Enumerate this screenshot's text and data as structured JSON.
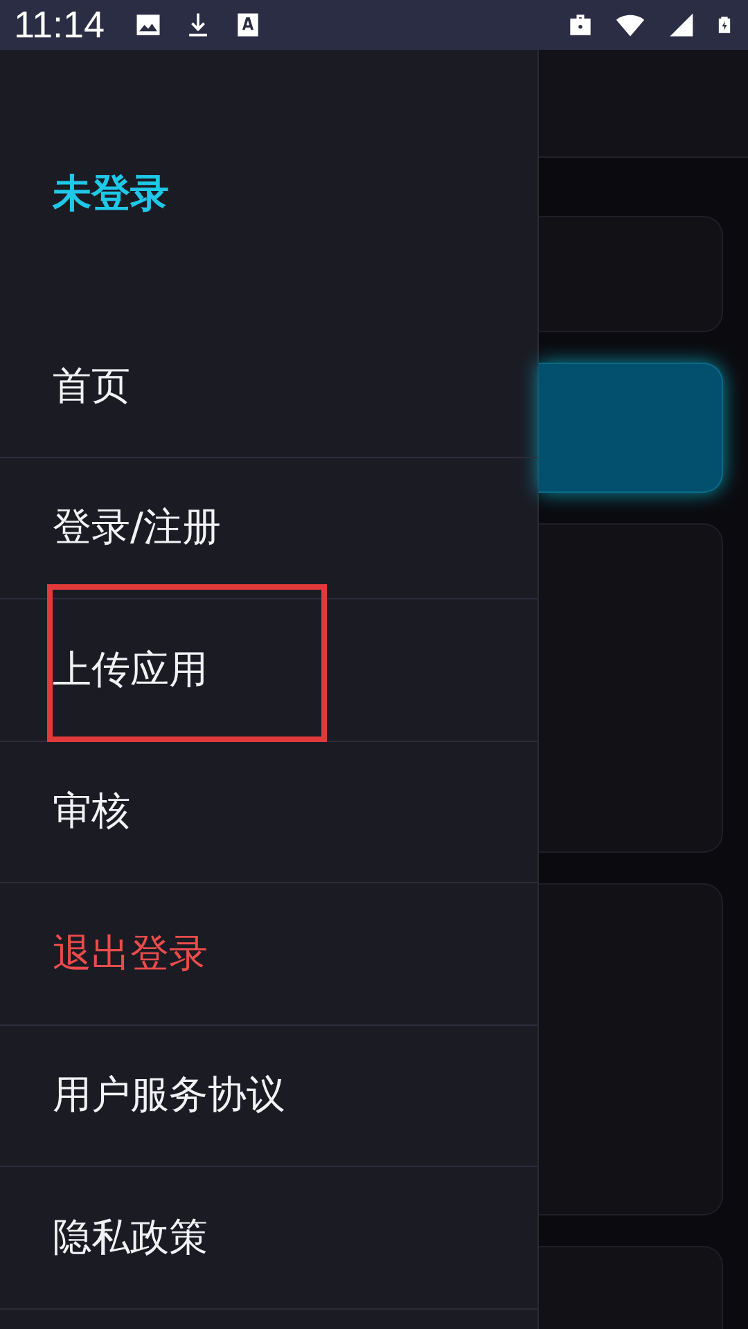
{
  "status_bar": {
    "time": "11:14"
  },
  "drawer": {
    "account_label": "未登录",
    "items": [
      {
        "label": "首页",
        "kind": "normal",
        "highlighted": false
      },
      {
        "label": "登录/注册",
        "kind": "normal",
        "highlighted": false
      },
      {
        "label": "上传应用",
        "kind": "normal",
        "highlighted": true
      },
      {
        "label": "审核",
        "kind": "normal",
        "highlighted": false
      },
      {
        "label": "退出登录",
        "kind": "danger",
        "highlighted": false
      },
      {
        "label": "用户服务协议",
        "kind": "normal",
        "highlighted": false
      },
      {
        "label": "隐私政策",
        "kind": "normal",
        "highlighted": false
      }
    ]
  }
}
